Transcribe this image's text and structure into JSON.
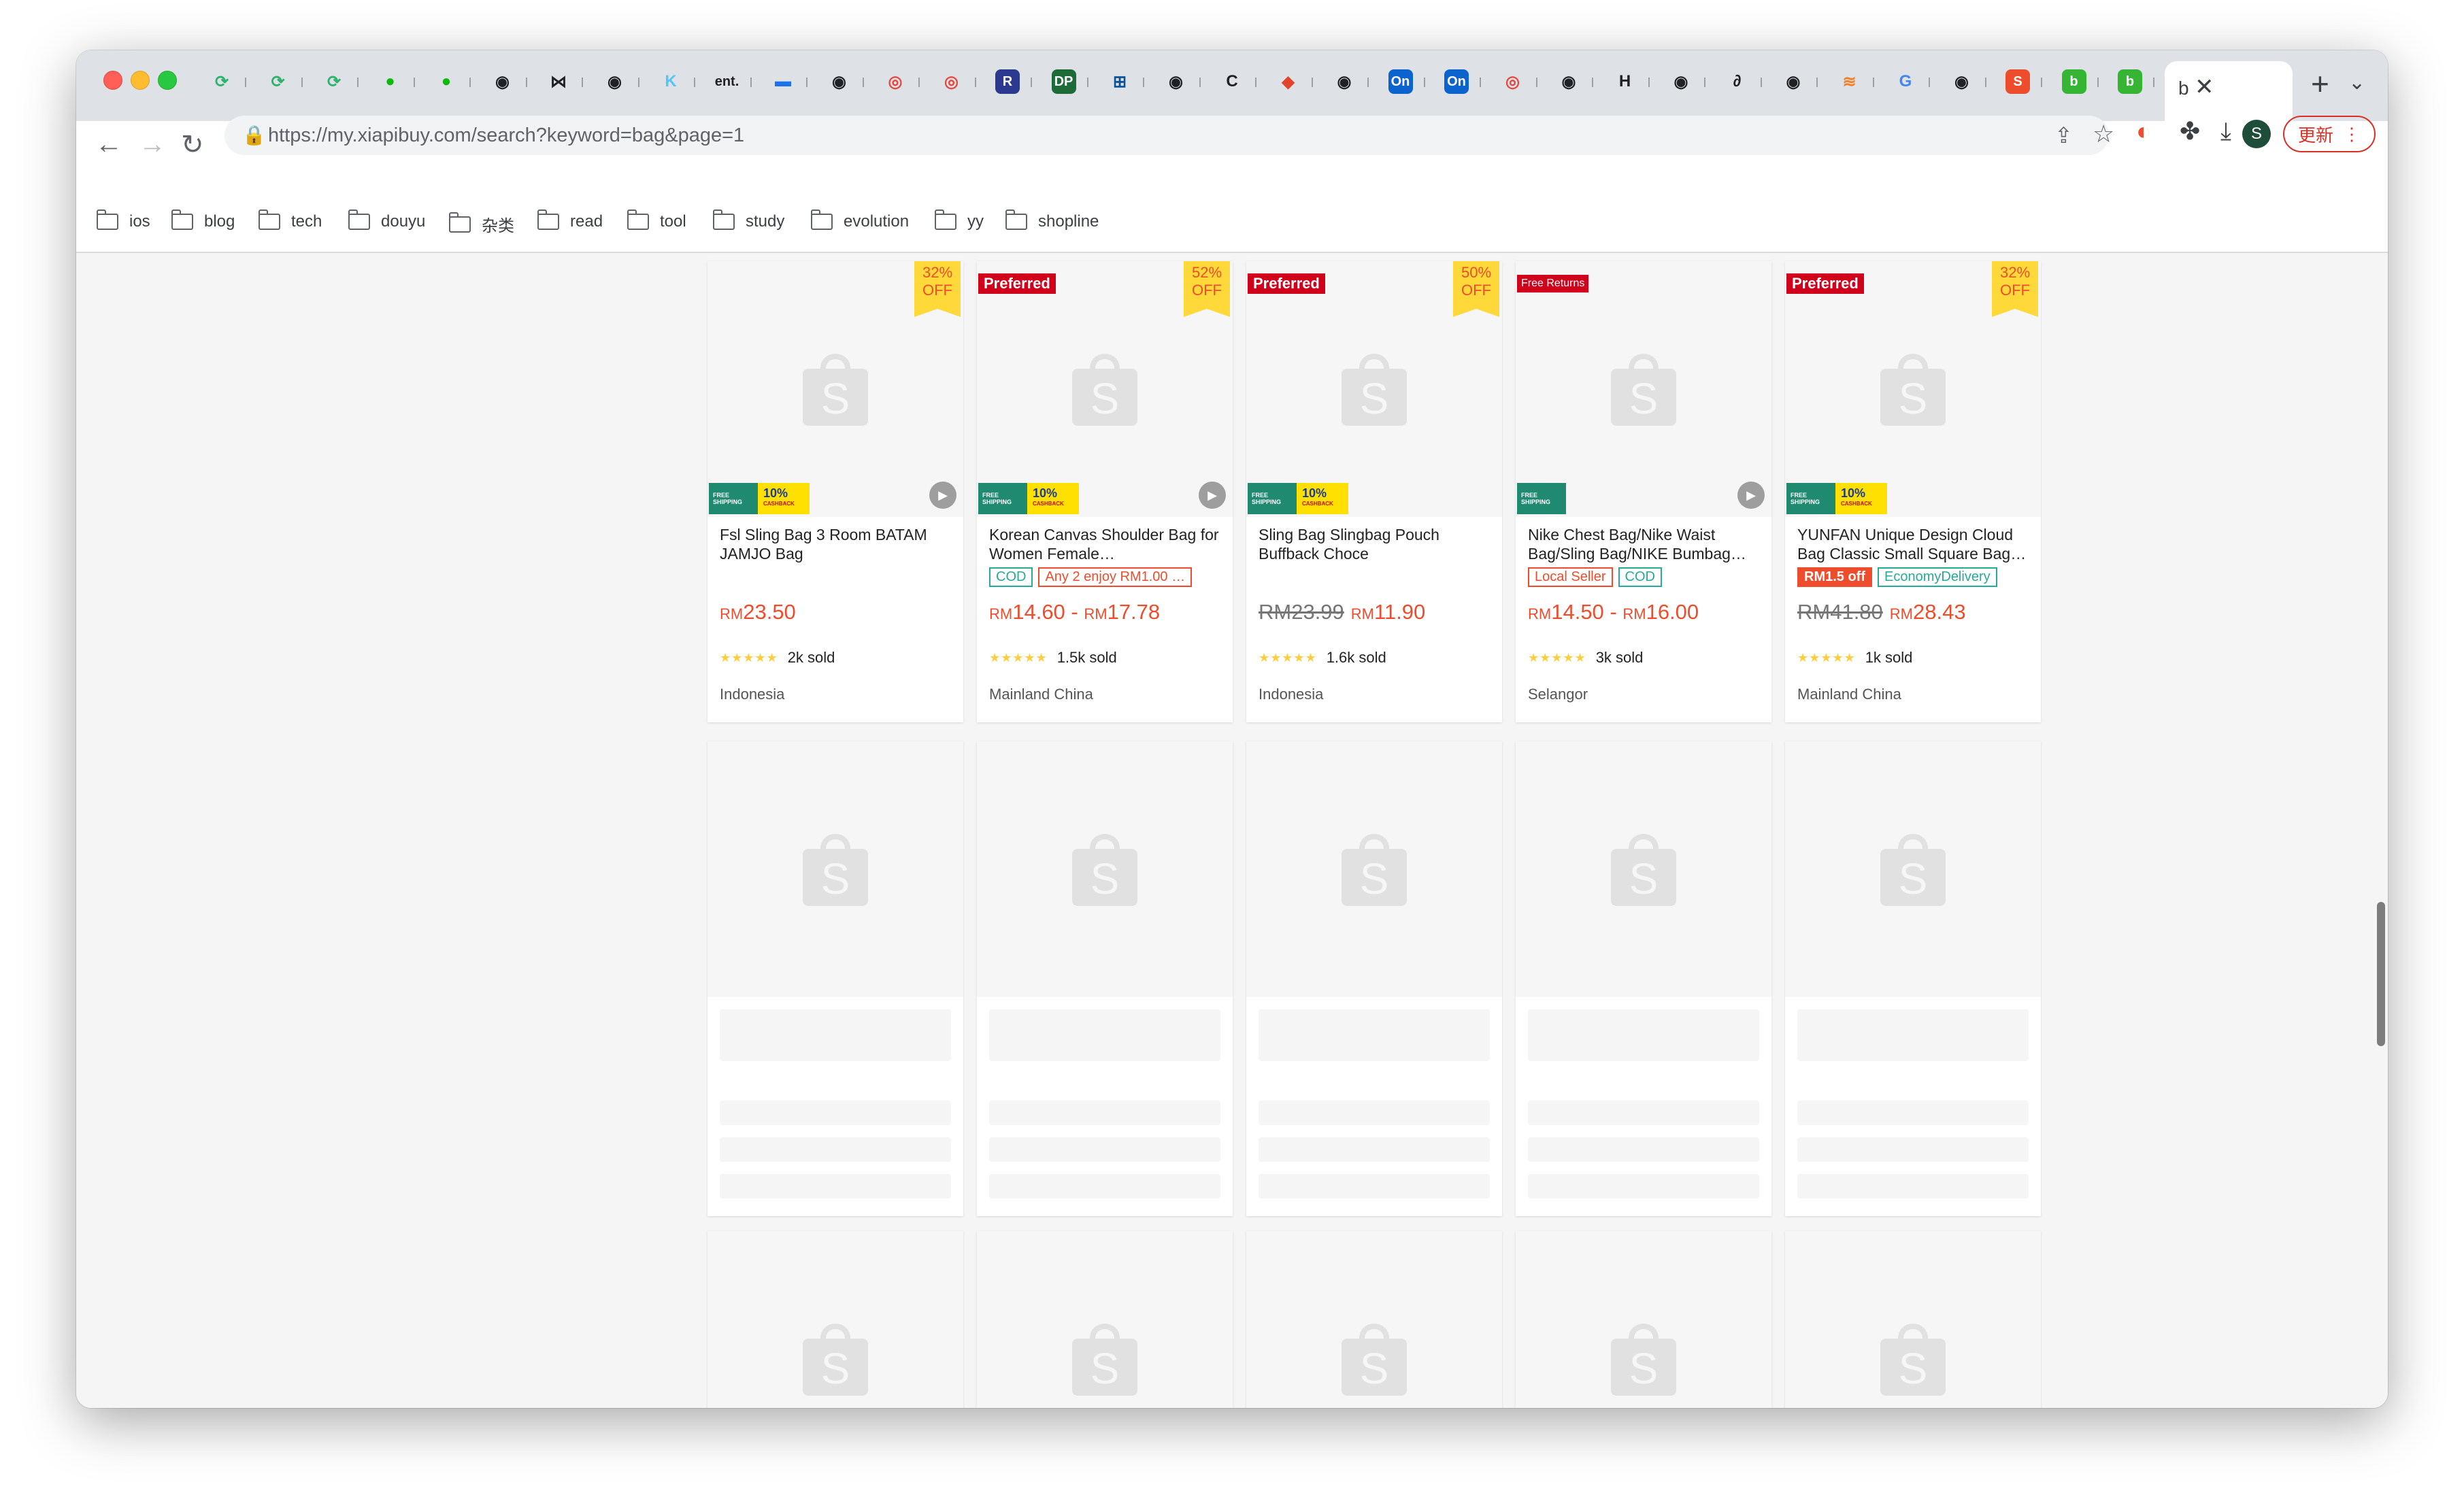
{
  "browser": {
    "url_host": "https://my.xiapibuy.com",
    "url_path": "/search?keyword=bag&page=1",
    "avatar_letter": "S",
    "update_label": "更新",
    "tab_labels": [
      "ent."
    ]
  },
  "bookmarks": [
    "ios",
    "blog",
    "tech",
    "douyu",
    "杂类",
    "read",
    "tool",
    "study",
    "evolution",
    "yy",
    "shopline"
  ],
  "promo": {
    "free_shipping": [
      "FREE",
      "SHIPPING"
    ],
    "cashback": "10%",
    "cashback_label": "CASHBACK"
  },
  "products": [
    {
      "title": "Fsl Sling Bag 3 Room BATAM JAMJO Bag",
      "discount": [
        "32%",
        "OFF"
      ],
      "corner_tag": "",
      "labels": [],
      "old_price": "",
      "price_parts": [
        "RM",
        "23.50"
      ],
      "sold": "2k sold",
      "location": "Indonesia",
      "has_cashback": true,
      "has_play": true
    },
    {
      "title": "Korean Canvas Shoulder Bag for Women Female…",
      "discount": [
        "52%",
        "OFF"
      ],
      "corner_tag": "Preferred",
      "labels": [
        {
          "text": "COD",
          "style": "teal"
        },
        {
          "text": "Any 2 enjoy RM1.00 …",
          "style": "red"
        }
      ],
      "old_price": "",
      "price_parts": [
        "RM",
        "14.60",
        " - ",
        "RM",
        "17.78"
      ],
      "sold": "1.5k sold",
      "location": "Mainland China",
      "has_cashback": true,
      "has_play": true
    },
    {
      "title": "Sling Bag Slingbag Pouch Buffback Choce",
      "discount": [
        "50%",
        "OFF"
      ],
      "corner_tag": "Preferred",
      "labels": [],
      "old_price": "RM23.99",
      "price_parts": [
        "RM",
        "11.90"
      ],
      "sold": "1.6k sold",
      "location": "Indonesia",
      "has_cashback": true,
      "has_play": false
    },
    {
      "title": "Nike Chest Bag/Nike Waist Bag/Sling Bag/NIKE Bumbag…",
      "discount": [],
      "corner_tag": "Free Returns",
      "labels": [
        {
          "text": "Local Seller",
          "style": "red"
        },
        {
          "text": "COD",
          "style": "teal"
        }
      ],
      "old_price": "",
      "price_parts": [
        "RM",
        "14.50",
        " - ",
        "RM",
        "16.00"
      ],
      "sold": "3k sold",
      "location": "Selangor",
      "has_cashback": false,
      "has_play": true
    },
    {
      "title": "YUNFAN Unique Design Cloud Bag Classic Small Square Bag…",
      "discount": [
        "32%",
        "OFF"
      ],
      "corner_tag": "Preferred",
      "labels": [
        {
          "text": "RM1.5 off",
          "style": "orangefill"
        },
        {
          "text": "EconomyDelivery",
          "style": "green"
        }
      ],
      "old_price": "RM41.80",
      "price_parts": [
        "RM",
        "28.43"
      ],
      "sold": "1k sold",
      "location": "Mainland China",
      "has_cashback": true,
      "has_play": false
    }
  ],
  "colors": {
    "brand_orange": "#ee4d2d",
    "preferred_red": "#d0011b",
    "discount_yellow": "#ffd839",
    "free_shipping_teal": "#1f8a70",
    "cashback_yellow": "#ffe000"
  }
}
